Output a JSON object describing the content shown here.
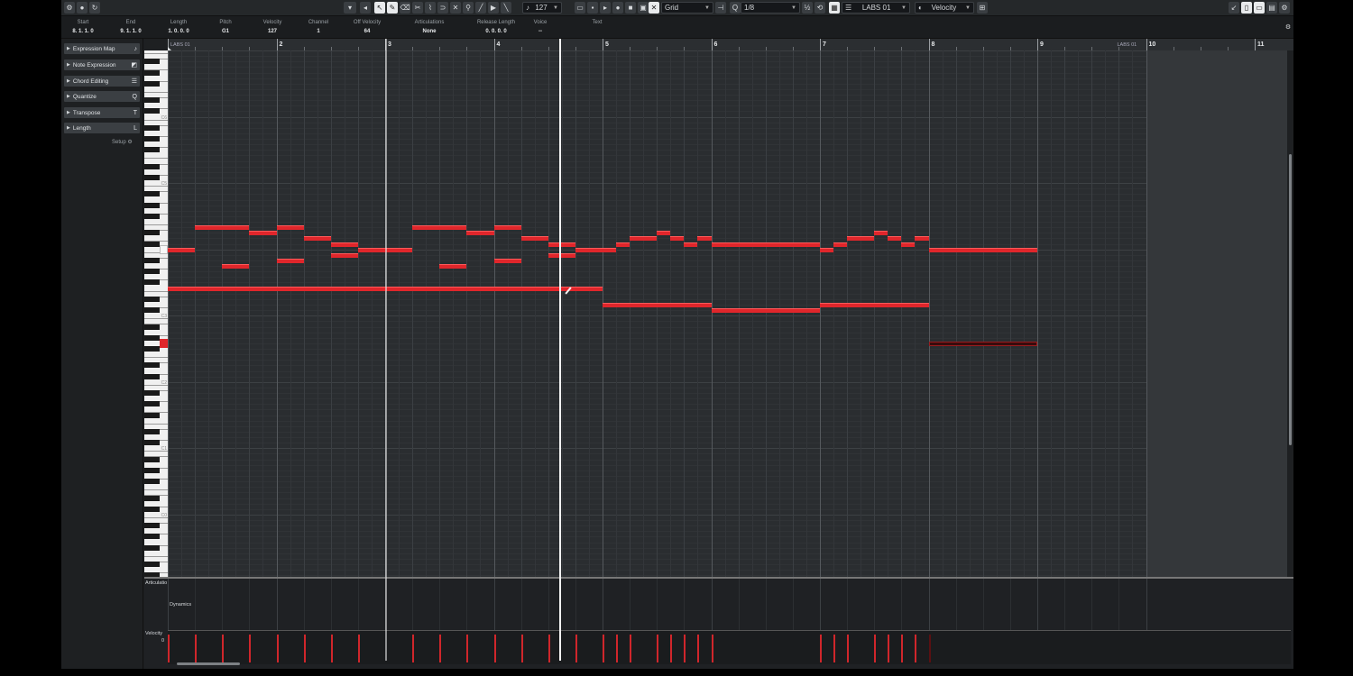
{
  "toolbar": {
    "quantize_value": "127",
    "grid_type": "Grid",
    "quantize_preset": "1/8",
    "track_name": "LABS 01",
    "controller": "Velocity"
  },
  "info_line": [
    {
      "label": "Start",
      "value": "8. 1. 1.  0"
    },
    {
      "label": "End",
      "value": "9. 1. 1.  0"
    },
    {
      "label": "Length",
      "value": "1. 0. 0.  0"
    },
    {
      "label": "Pitch",
      "value": "G1"
    },
    {
      "label": "Velocity",
      "value": "127"
    },
    {
      "label": "Channel",
      "value": "1"
    },
    {
      "label": "Off Velocity",
      "value": "64"
    },
    {
      "label": "Articulations",
      "value": "None"
    },
    {
      "label": "Release Length",
      "value": "0. 0. 0.  0"
    },
    {
      "label": "Voice",
      "value": "--"
    },
    {
      "label": "Text",
      "value": ""
    }
  ],
  "inspector": {
    "sections": [
      {
        "label": "Expression Map",
        "icon": "expression-map-icon"
      },
      {
        "label": "Note Expression",
        "icon": "note-expression-icon"
      },
      {
        "label": "Chord Editing",
        "icon": "chord-editing-icon"
      },
      {
        "label": "Quantize",
        "icon": "quantize-icon",
        "glyph": "Q"
      },
      {
        "label": "Transpose",
        "icon": "transpose-icon",
        "glyph": "T"
      },
      {
        "label": "Length",
        "icon": "length-icon",
        "glyph": "L"
      }
    ],
    "setup_label": "Setup"
  },
  "ruler": {
    "bars": [
      "2",
      "3",
      "4",
      "5",
      "6",
      "7",
      "8",
      "9",
      "10",
      "11"
    ],
    "start_marker": "LABS 01",
    "end_marker": "LABS 01"
  },
  "keyboard": {
    "octave_labels": [
      "C6",
      "C5",
      "C4",
      "C3",
      "C2",
      "C1",
      "C0"
    ]
  },
  "lanes": {
    "articulation_label": "Articulatio",
    "dynamics_label": "Dynamics",
    "velocity_label": "Velocity",
    "velocity_value": "0"
  },
  "notes": [
    {
      "start": 1.0,
      "len": 0.25,
      "pitch": 60
    },
    {
      "start": 1.25,
      "len": 0.5,
      "pitch": 64
    },
    {
      "start": 1.5,
      "len": 0.25,
      "pitch": 57
    },
    {
      "start": 1.75,
      "len": 0.25,
      "pitch": 63
    },
    {
      "start": 2.0,
      "len": 0.25,
      "pitch": 64
    },
    {
      "start": 2.0,
      "len": 0.25,
      "pitch": 58
    },
    {
      "start": 2.25,
      "len": 0.25,
      "pitch": 62
    },
    {
      "start": 2.5,
      "len": 0.25,
      "pitch": 61
    },
    {
      "start": 2.5,
      "len": 0.25,
      "pitch": 59
    },
    {
      "start": 2.75,
      "len": 0.5,
      "pitch": 60
    },
    {
      "start": 3.25,
      "len": 0.5,
      "pitch": 64
    },
    {
      "start": 3.5,
      "len": 0.25,
      "pitch": 57
    },
    {
      "start": 3.75,
      "len": 0.25,
      "pitch": 63
    },
    {
      "start": 4.0,
      "len": 0.25,
      "pitch": 64
    },
    {
      "start": 4.0,
      "len": 0.25,
      "pitch": 58
    },
    {
      "start": 4.25,
      "len": 0.25,
      "pitch": 62
    },
    {
      "start": 4.5,
      "len": 0.25,
      "pitch": 61
    },
    {
      "start": 4.5,
      "len": 0.25,
      "pitch": 59
    },
    {
      "start": 4.75,
      "len": 0.375,
      "pitch": 60
    },
    {
      "start": 5.125,
      "len": 0.125,
      "pitch": 61
    },
    {
      "start": 5.25,
      "len": 0.25,
      "pitch": 62
    },
    {
      "start": 5.5,
      "len": 0.125,
      "pitch": 63
    },
    {
      "start": 5.625,
      "len": 0.125,
      "pitch": 62
    },
    {
      "start": 5.75,
      "len": 0.125,
      "pitch": 61
    },
    {
      "start": 5.875,
      "len": 0.125,
      "pitch": 62
    },
    {
      "start": 6.0,
      "len": 1.0,
      "pitch": 61
    },
    {
      "start": 7.0,
      "len": 0.125,
      "pitch": 60
    },
    {
      "start": 7.125,
      "len": 0.125,
      "pitch": 61
    },
    {
      "start": 7.25,
      "len": 0.25,
      "pitch": 62
    },
    {
      "start": 7.5,
      "len": 0.125,
      "pitch": 63
    },
    {
      "start": 7.625,
      "len": 0.125,
      "pitch": 62
    },
    {
      "start": 7.75,
      "len": 0.125,
      "pitch": 61
    },
    {
      "start": 7.875,
      "len": 0.125,
      "pitch": 62
    },
    {
      "start": 8.0,
      "len": 1.0,
      "pitch": 60
    },
    {
      "start": 1.0,
      "len": 4.0,
      "pitch": 53
    },
    {
      "start": 5.0,
      "len": 1.0,
      "pitch": 50
    },
    {
      "start": 6.0,
      "len": 1.0,
      "pitch": 49
    },
    {
      "start": 7.0,
      "len": 1.0,
      "pitch": 50
    },
    {
      "start": 8.0,
      "len": 1.0,
      "pitch": 43,
      "selected": true
    }
  ],
  "colors": {
    "note": "#e0262b",
    "velocity": "#d0262b",
    "cursor": "#f2f2f2"
  },
  "cursor_position": 4.6,
  "locator_position": 3.0
}
